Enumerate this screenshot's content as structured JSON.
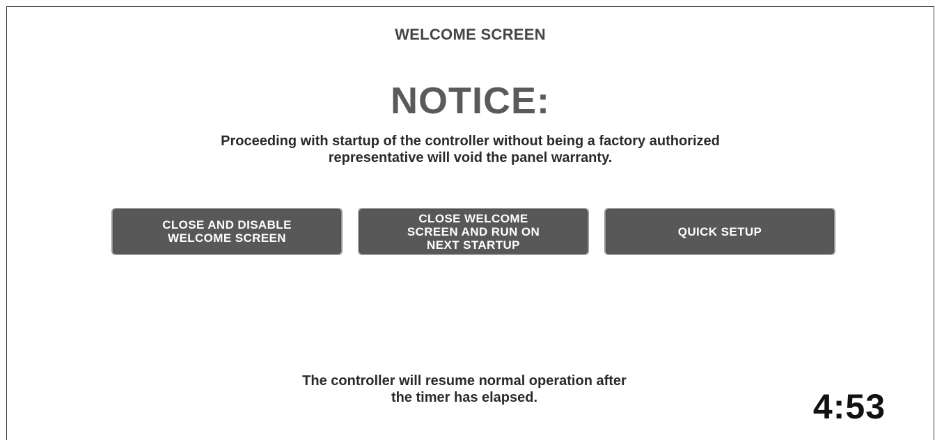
{
  "header": {
    "title": "WELCOME SCREEN"
  },
  "notice": {
    "heading": "NOTICE:",
    "line1": "Proceeding with startup of the controller without being a factory authorized",
    "line2": "representative will void the panel warranty."
  },
  "buttons": {
    "close_disable": {
      "line1": "CLOSE AND DISABLE",
      "line2": "WELCOME SCREEN"
    },
    "close_run_next": {
      "line1": "CLOSE WELCOME",
      "line2": "SCREEN AND RUN ON",
      "line3": "NEXT STARTUP"
    },
    "quick_setup": {
      "label": "QUICK SETUP"
    }
  },
  "footer": {
    "line1": "The controller will resume normal operation after",
    "line2": "the timer has elapsed."
  },
  "timer": {
    "value": "4:53"
  },
  "colors": {
    "button_bg": "#585858",
    "button_border": "#9a9a9a",
    "heading": "#5a5a5a",
    "text": "#2a2a2a"
  }
}
